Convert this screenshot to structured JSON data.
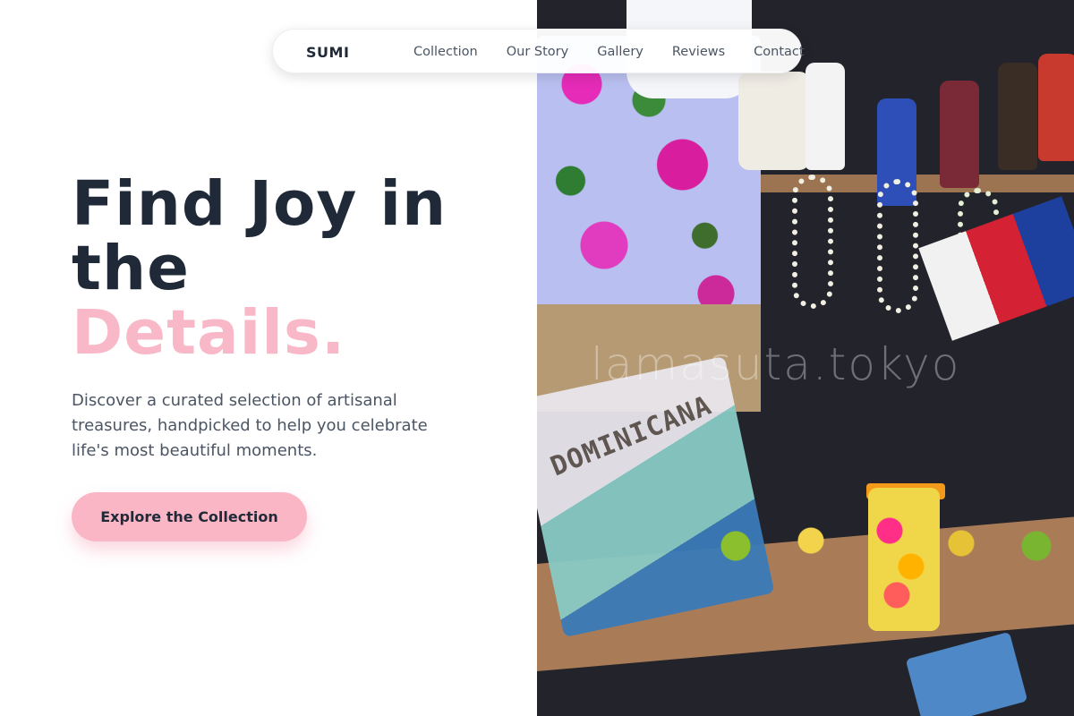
{
  "navbar": {
    "brand": "SUMI",
    "links": [
      "Collection",
      "Our Story",
      "Gallery",
      "Reviews",
      "Contact"
    ]
  },
  "hero": {
    "headline_line1": "Find Joy in",
    "headline_line2": "the",
    "headline_accent": "Details.",
    "subtext": "Discover a curated selection of artisanal treasures, handpicked to help you celebrate life's most beautiful moments.",
    "cta_label": "Explore the Collection"
  },
  "image": {
    "watermark": "lamasuta.tokyo",
    "bag_text": "DOMINICANA"
  },
  "colors": {
    "accent_pink": "#f9b8c8",
    "button_pink": "#fbb6c6",
    "heading_dark": "#1f2937",
    "body_gray": "#4b5563"
  }
}
